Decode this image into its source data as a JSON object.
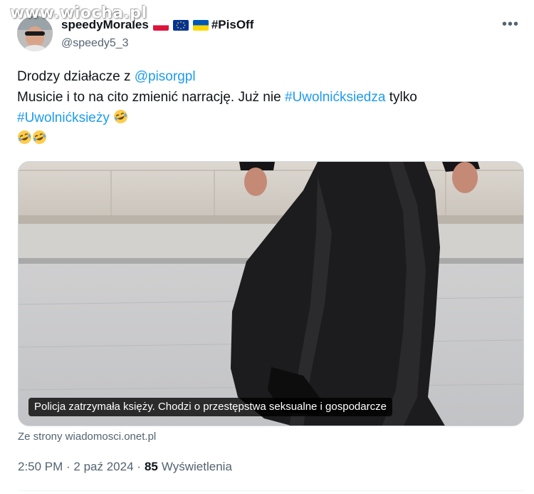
{
  "watermark": {
    "text": "www.wiocha.pl"
  },
  "tweet": {
    "author": {
      "display_name": "speedyMorales",
      "hashtag_suffix": "#PisOff",
      "handle": "@speedy5_3",
      "flags": [
        "poland-flag",
        "eu-flag",
        "ukraine-flag"
      ]
    },
    "more_label": "•••",
    "text": {
      "line1_prefix": "Drodzy działacze z ",
      "line1_mention": "@pisorgpl",
      "line2_prefix": "Musicie i to na cito zmienić narrację. Już nie ",
      "line2_hashtag": "#Uwolnićksiedza",
      "line2_suffix": " tylko",
      "line3_hashtag": "#Uwolnićksieży"
    },
    "emoji_name": "rolling-on-the-floor-laughing",
    "media": {
      "caption": "Policja zatrzymała księży. Chodzi o przestępstwa seksualne i gospodarcze"
    },
    "source": "Ze strony wiadomosci.onet.pl",
    "timestamp": "2:50 PM · 2 paź 2024 · ",
    "views_count": "85",
    "views_label": "Wyświetlenia"
  },
  "colors": {
    "link": "#1d9bf0",
    "secondary_text": "#536471",
    "primary_text": "#0f1419",
    "border": "#cfd9de"
  }
}
